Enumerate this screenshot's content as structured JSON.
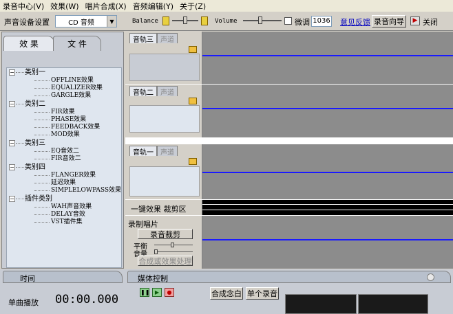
{
  "menu": [
    "录音中心(V)",
    "效果(W)",
    "唱片合成(X)",
    "音频编辑(Y)",
    "关于(Z)"
  ],
  "toolbar": {
    "device_label": "声音设备设置",
    "device_value": "CD 音频",
    "balance_label": "Balance",
    "volume_label": "Volume",
    "fine_tune_label": "微调",
    "fine_tune_value": "1036",
    "feedback_link": "意见反馈",
    "wizard_button": "录音向导",
    "close_button": "关闭"
  },
  "left_tabs": [
    "效 果",
    "文 件"
  ],
  "tree": [
    {
      "label": "类别一",
      "children": [
        "OFFLINE效果",
        "EQUALIZER效果",
        "GARGLE效果"
      ]
    },
    {
      "label": "类别二",
      "children": [
        "FIR效果",
        "PHASE效果",
        "FEEDBACK效果",
        "MOD效果"
      ]
    },
    {
      "label": "类别三",
      "children": [
        "EQ音效二",
        "FIR音效二"
      ]
    },
    {
      "label": "类别四",
      "children": [
        "FLANGER效果",
        "延迟效果",
        "SIMPLELOWPASS效果"
      ]
    },
    {
      "label": "插件类别",
      "children": [
        "WAH声音效果",
        "DELAY音效",
        "VST插件集"
      ]
    }
  ],
  "tracks": [
    {
      "name": "音轨三",
      "tab2": "声道"
    },
    {
      "name": "音轨二",
      "tab2": "声道"
    },
    {
      "name": "音轨一",
      "tab2": "声道"
    }
  ],
  "effects_bar": {
    "label": "一键效果 裁剪区"
  },
  "record_panel": {
    "title": "录制唱片",
    "cut_button": "录音裁剪",
    "balance": "平衡",
    "volume": "音量",
    "mix_button": "合成或效果处理"
  },
  "time_panel": {
    "title": "时间",
    "label": "单曲播放",
    "value": "00:00.000"
  },
  "media_panel": {
    "title": "媒体控制",
    "burn_button": "合成念白",
    "single_button": "单个录音"
  }
}
